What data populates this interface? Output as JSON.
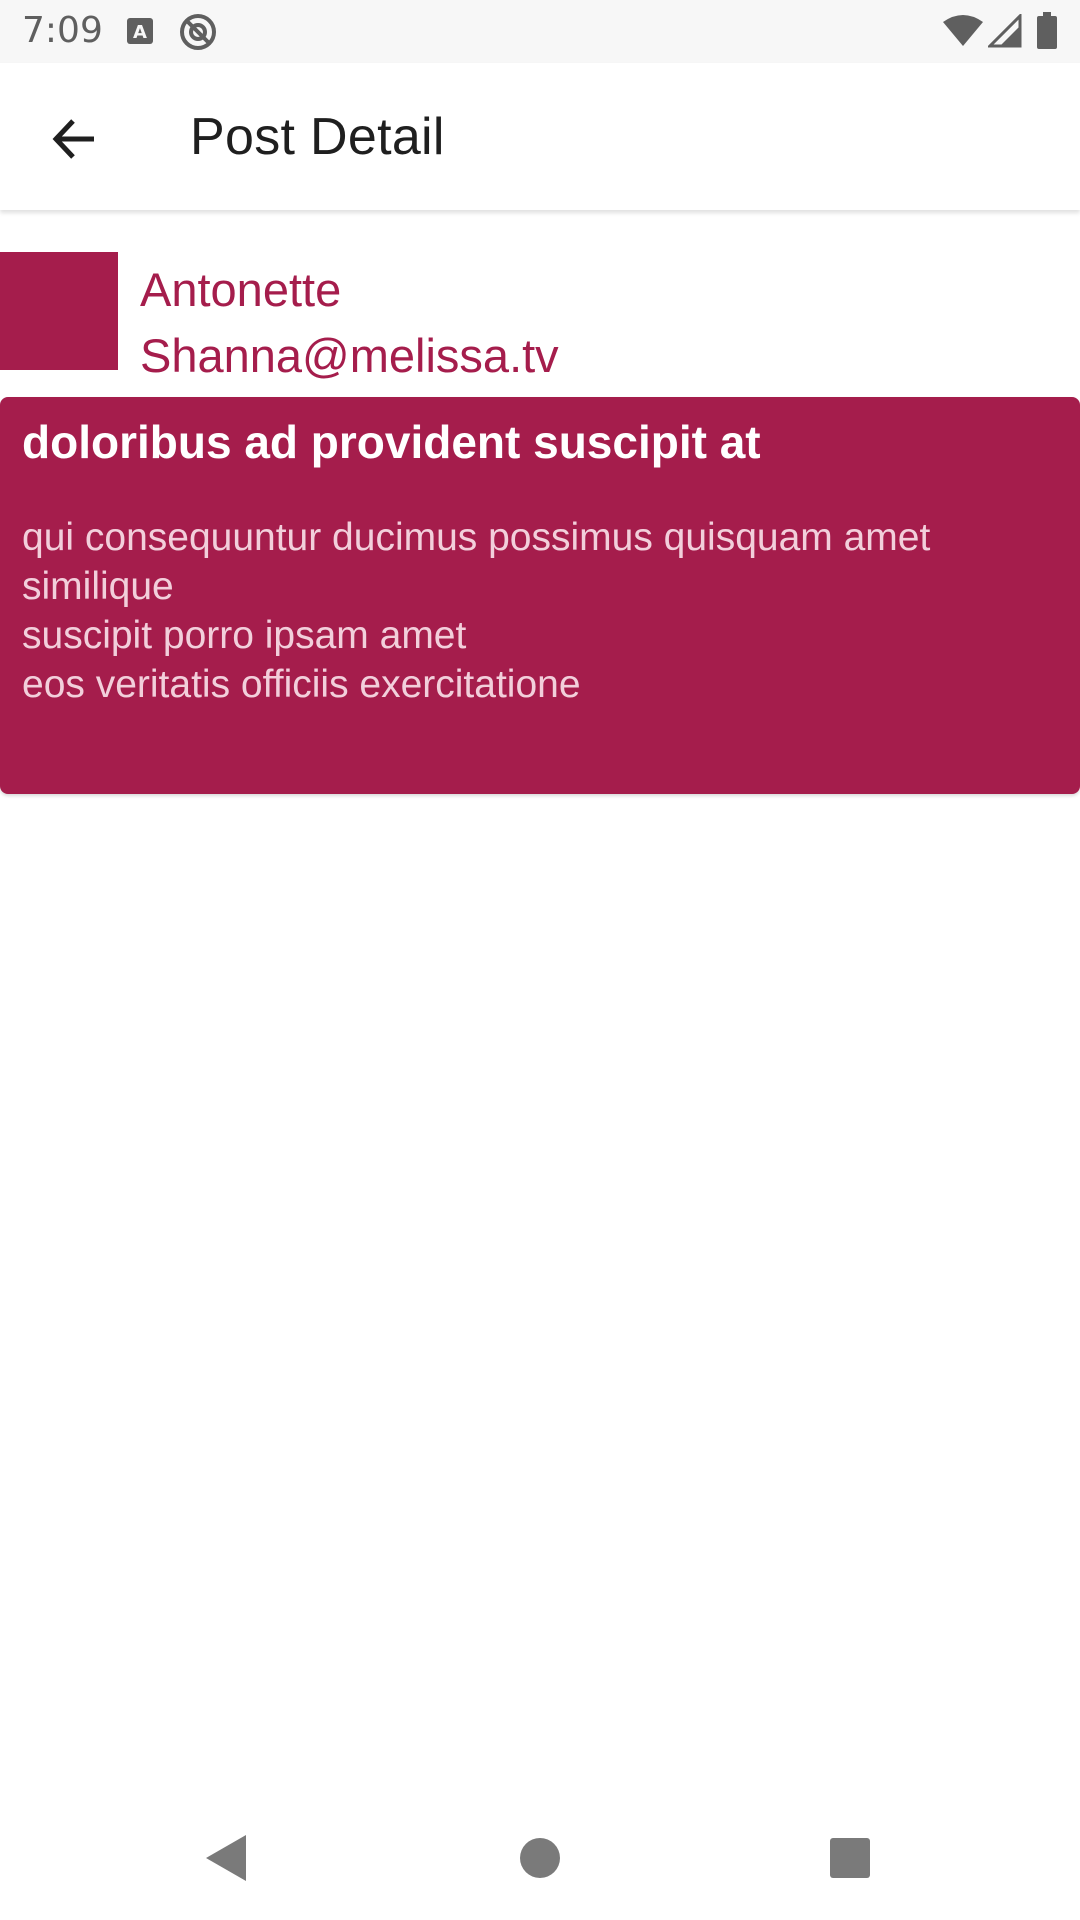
{
  "status_bar": {
    "time": "7:09",
    "icons": [
      "font-download-icon",
      "at-sign-icon",
      "wifi-icon",
      "cellular-signal-icon",
      "battery-icon"
    ]
  },
  "app_bar": {
    "title": "Post Detail",
    "back_icon": "arrow-back-icon"
  },
  "author": {
    "name": "Antonette",
    "email": "Shanna@melissa.tv"
  },
  "post": {
    "title": "doloribus ad provident suscipit at",
    "body": "qui consequuntur ducimus possimus quisquam amet similique\nsuscipit porro ipsam amet\neos veritatis officiis exercitatione"
  },
  "nav_bar": {
    "icons": [
      "back-triangle-icon",
      "home-circle-icon",
      "recents-square-icon"
    ]
  },
  "colors": {
    "accent": "#a51d4c",
    "card_text": "#ffffff",
    "card_body_text": "#f2cfdb"
  }
}
